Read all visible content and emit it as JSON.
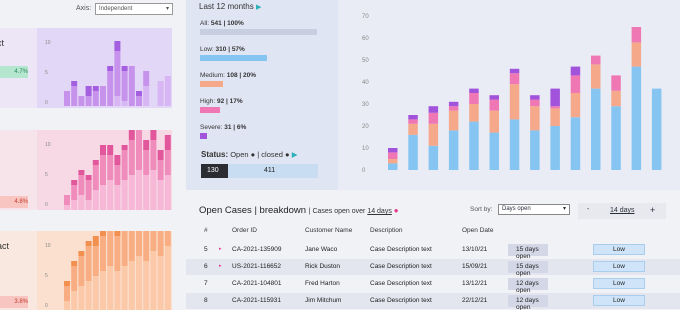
{
  "axis": {
    "label": "Axis:",
    "value": "Independent"
  },
  "panels": [
    {
      "title": "act",
      "badge": "4.7%",
      "badge_bg": "#b5e6cf",
      "badge_color": "#2a8a5a",
      "bg": "#ece6f6",
      "chart_bg": "#e3d7f7",
      "colors": [
        "#d7b6f3",
        "#c792ec",
        "#a45fe0"
      ]
    },
    {
      "title": "",
      "badge": "4.8%",
      "badge_bg": "#f9c5c0",
      "badge_color": "#c0392b",
      "bg": "#f7e4ea",
      "chart_bg": "#f7d9e6",
      "colors": [
        "#f6b8d6",
        "#ef8cbc",
        "#e2579b"
      ]
    },
    {
      "title": "pact",
      "badge": "3.8%",
      "badge_bg": "#f9c5c0",
      "badge_color": "#c0392b",
      "bg": "#f9e8df",
      "chart_bg": "#fbe0cf",
      "colors": [
        "#fbc8a8",
        "#f8ae82",
        "#f1904f"
      ]
    }
  ],
  "panel_ticks": [
    "10",
    "5",
    "0"
  ],
  "filter": {
    "header": "Last 12 months",
    "rows": [
      {
        "label_name": "All:",
        "label_value": "541 | 100%",
        "fraction": 1.0,
        "color": "#c7cee0"
      },
      {
        "label_name": "Low:",
        "label_value": "310 | 57%",
        "fraction": 0.57,
        "color": "#86c5f2"
      },
      {
        "label_name": "Medium:",
        "label_value": "108 | 20%",
        "fraction": 0.2,
        "color": "#f6a88a"
      },
      {
        "label_name": "High:",
        "label_value": "92 | 17%",
        "fraction": 0.17,
        "color": "#ef78b4"
      },
      {
        "label_name": "Severe:",
        "label_value": "31 | 6%",
        "fraction": 0.06,
        "color": "#a253dc"
      }
    ],
    "status_label": "Status:",
    "status_text": "Open ● | closed ●",
    "open_count": "130",
    "closed_count": "411"
  },
  "chart_data": {
    "type": "bar",
    "stacked": true,
    "ylim": [
      0,
      70
    ],
    "yticks": [
      "0",
      "10",
      "20",
      "30",
      "40",
      "50",
      "60",
      "70"
    ],
    "series": [
      {
        "color": "#86c5f2",
        "values": [
          3,
          16,
          11,
          18,
          22,
          17,
          23,
          18,
          20,
          24,
          37,
          29,
          47,
          37
        ]
      },
      {
        "color": "#f6a88a",
        "values": [
          2,
          5,
          10,
          9,
          8,
          10,
          16,
          11,
          8,
          11,
          11,
          7,
          11,
          0
        ]
      },
      {
        "color": "#ef78b4",
        "values": [
          3,
          2,
          5,
          2,
          5,
          5,
          5,
          3,
          1,
          8,
          4,
          7,
          7,
          0
        ]
      },
      {
        "color": "#a253dc",
        "values": [
          2,
          2,
          3,
          2,
          2,
          2,
          2,
          2,
          8,
          4,
          0,
          0,
          0,
          0
        ]
      }
    ]
  },
  "cases": {
    "title": "Open Cases | breakdown",
    "subtitle_prefix": "Cases open over",
    "subtitle_days": "14 days",
    "sort_label": "Sort by:",
    "sort_value": "Days open",
    "stepper_minus": "-",
    "stepper_value": "14 days",
    "stepper_plus": "+",
    "columns": [
      "#",
      "Order ID",
      "Customer Name",
      "Description",
      "Open Date"
    ],
    "rows": [
      {
        "num": "5",
        "marker": "▸",
        "marker_color": "#e13b8f",
        "order": "CA-2021-135909",
        "customer": "Jane Waco",
        "desc": "Case Description text",
        "date": "13/10/21",
        "days": "15 days open",
        "priority": "Low"
      },
      {
        "num": "6",
        "marker": "▸",
        "marker_color": "#e13b8f",
        "order": "US-2021-116652",
        "customer": "Rick Duston",
        "desc": "Case Description text",
        "date": "15/09/21",
        "days": "15 days open",
        "priority": "Low"
      },
      {
        "num": "7",
        "marker": "",
        "marker_color": "#000",
        "order": "CA-2021-104801",
        "customer": "Fred Harton",
        "desc": "Case Description text",
        "date": "13/12/21",
        "days": "12 days open",
        "priority": "Low"
      },
      {
        "num": "8",
        "marker": "",
        "marker_color": "#000",
        "order": "CA-2021-115931",
        "customer": "Jim Mitchum",
        "desc": "Case Description text",
        "date": "22/12/21",
        "days": "12 days open",
        "priority": "Low"
      }
    ]
  }
}
